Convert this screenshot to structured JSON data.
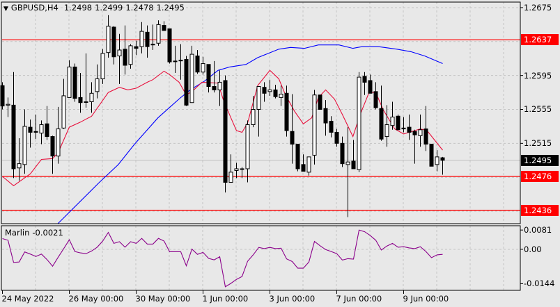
{
  "header": {
    "symbol": "GBPUSD,H4",
    "open": "1.2498",
    "high": "1.2499",
    "low": "1.2478",
    "close": "1.2495"
  },
  "price_axis": {
    "labels": [
      "1.2675",
      "1.2595",
      "1.2555",
      "1.2515"
    ],
    "range": [
      1.24203,
      1.26815
    ],
    "grid_step": 0.004,
    "grid_top": 1.2675
  },
  "levels": [
    {
      "label": "1.2637",
      "price": 1.2637,
      "color": "#ff0000"
    },
    {
      "label": "1.2476",
      "price": 1.2476,
      "color": "#ff0000"
    },
    {
      "label": "1.2436",
      "price": 1.2436,
      "color": "#ff0000"
    }
  ],
  "current_price": {
    "label": "1.2495",
    "price": 1.2495,
    "color": "#000000"
  },
  "indicator": {
    "name": "Marlin",
    "value": "-0.0021",
    "color": "#8b008b",
    "axis_labels": [
      {
        "label": "0.0081",
        "value": 0.0081
      },
      {
        "label": "0.00",
        "value": 0
      },
      {
        "label": "-0.0144",
        "value": -0.0144
      }
    ],
    "range": [
      -0.0172,
      0.0099
    ],
    "values": [
      0.0045,
      0.0038,
      -0.0055,
      -0.0053,
      -0.0011,
      -0.002,
      -0.003,
      -0.002,
      -0.0043,
      -0.0071,
      -0.0033,
      0.0003,
      0.004,
      -0.0009,
      -0.0015,
      -0.0018,
      -0.0007,
      0.0009,
      0.0035,
      0.0071,
      0.0025,
      0.0032,
      0.0009,
      0.0032,
      0.0025,
      0.0046,
      0.0022,
      0.0022,
      0.0046,
      0.0035,
      -0.001,
      -0.001,
      -0.001,
      -0.0069,
      0.0001,
      -0.0021,
      -0.0013,
      -0.0038,
      -0.0044,
      -0.0031,
      -0.0157,
      -0.0143,
      -0.0126,
      -0.0114,
      -0.005,
      -0.0023,
      0.0008,
      0.0003,
      0.0008,
      0.0003,
      0.0005,
      -0.004,
      -0.0051,
      -0.0079,
      -0.0079,
      -0.0053,
      0.0033,
      0.0015,
      -0.0001,
      -0.0009,
      -0.0018,
      -0.0045,
      -0.0039,
      -0.0041,
      0.0081,
      0.0074,
      0.0058,
      0.0038,
      -0.0003,
      0.0014,
      0.0025,
      0.0009,
      0.0011,
      0.0006,
      0.0003,
      0.0011,
      -0.0009,
      -0.0035,
      -0.0023,
      -0.0021
    ]
  },
  "time_axis": {
    "labels": [
      {
        "label": "24 May 2022",
        "bar": 0
      },
      {
        "label": "26 May 00:00",
        "bar": 12
      },
      {
        "label": "30 May 00:00",
        "bar": 24
      },
      {
        "label": "1 Jun 00:00",
        "bar": 36
      },
      {
        "label": "3 Jun 00:00",
        "bar": 48
      },
      {
        "label": "7 Jun 00:00",
        "bar": 60
      },
      {
        "label": "9 Jun 00:00",
        "bar": 72
      }
    ]
  },
  "colors": {
    "ma_fast": "#e8103c",
    "ma_slow": "#0000ff",
    "level": "#ff0000",
    "background": "#e8e8e8"
  },
  "ma_fast": [
    [
      0,
      1.2476
    ],
    [
      2,
      1.2465
    ],
    [
      5,
      1.2479
    ],
    [
      7,
      1.2496
    ],
    [
      9,
      1.2497
    ],
    [
      10,
      1.2504
    ],
    [
      12,
      1.2534
    ],
    [
      14,
      1.254
    ],
    [
      16,
      1.2547
    ],
    [
      17.5,
      1.2561
    ],
    [
      19,
      1.2575
    ],
    [
      21,
      1.2581
    ],
    [
      22.5,
      1.2578
    ],
    [
      24,
      1.258
    ],
    [
      26,
      1.2587
    ],
    [
      27,
      1.259
    ],
    [
      29,
      1.26
    ],
    [
      30,
      1.2596
    ],
    [
      31.7,
      1.2587
    ],
    [
      33,
      1.2572
    ],
    [
      34.2,
      1.2577
    ],
    [
      35.8,
      1.2587
    ],
    [
      38.7,
      1.2586
    ],
    [
      39.6,
      1.2567
    ],
    [
      41,
      1.2545
    ],
    [
      42,
      1.253
    ],
    [
      43,
      1.2528
    ],
    [
      44,
      1.2539
    ],
    [
      45.8,
      1.2583
    ],
    [
      48,
      1.2601
    ],
    [
      49.6,
      1.2591
    ],
    [
      50.8,
      1.2572
    ],
    [
      52.4,
      1.2553
    ],
    [
      54,
      1.2538
    ],
    [
      55.5,
      1.2545
    ],
    [
      56.7,
      1.2569
    ],
    [
      58,
      1.2578
    ],
    [
      59.6,
      1.2567
    ],
    [
      61,
      1.2549
    ],
    [
      62.9,
      1.2523
    ],
    [
      64.2,
      1.2549
    ],
    [
      65.8,
      1.2575
    ],
    [
      67,
      1.2575
    ],
    [
      68.3,
      1.2555
    ],
    [
      70.4,
      1.2532
    ],
    [
      72,
      1.2526
    ],
    [
      75,
      1.2532
    ],
    [
      76.2,
      1.253
    ],
    [
      79,
      1.2507
    ]
  ],
  "ma_slow": [
    [
      9.9,
      1.242
    ],
    [
      17.4,
      1.2469
    ],
    [
      20.8,
      1.249
    ],
    [
      23.7,
      1.2514
    ],
    [
      27.9,
      1.2545
    ],
    [
      32,
      1.2569
    ],
    [
      33.7,
      1.2578
    ],
    [
      36.2,
      1.2588
    ],
    [
      38.7,
      1.2601
    ],
    [
      40.8,
      1.2605
    ],
    [
      43.7,
      1.2608
    ],
    [
      45.8,
      1.2616
    ],
    [
      49.6,
      1.2626
    ],
    [
      51.7,
      1.2628
    ],
    [
      54.2,
      1.2627
    ],
    [
      56.7,
      1.2631
    ],
    [
      60.4,
      1.2631
    ],
    [
      62.9,
      1.2627
    ],
    [
      64.6,
      1.2629
    ],
    [
      67.4,
      1.2629
    ],
    [
      70.8,
      1.2626
    ],
    [
      73.3,
      1.2623
    ],
    [
      75.8,
      1.2618
    ],
    [
      79,
      1.2609
    ]
  ],
  "candles": [
    [
      1.2583,
      1.2587,
      1.2555,
      1.2559
    ],
    [
      1.256,
      1.2569,
      1.2546,
      1.2561
    ],
    [
      1.256,
      1.2599,
      1.2474,
      1.2485
    ],
    [
      1.2486,
      1.2521,
      1.2471,
      1.2491
    ],
    [
      1.249,
      1.2555,
      1.2479,
      1.2535
    ],
    [
      1.2534,
      1.2543,
      1.251,
      1.2528
    ],
    [
      1.2529,
      1.2549,
      1.252,
      1.2528
    ],
    [
      1.2527,
      1.2542,
      1.2514,
      1.2537
    ],
    [
      1.2538,
      1.2559,
      1.2519,
      1.2523
    ],
    [
      1.2523,
      1.2524,
      1.2479,
      1.25
    ],
    [
      1.25,
      1.2558,
      1.2491,
      1.2532
    ],
    [
      1.2533,
      1.2591,
      1.2532,
      1.2571
    ],
    [
      1.2569,
      1.2613,
      1.2569,
      1.2605
    ],
    [
      1.2605,
      1.2609,
      1.2564,
      1.2568
    ],
    [
      1.2569,
      1.2598,
      1.2551,
      1.2563
    ],
    [
      1.2564,
      1.2621,
      1.2557,
      1.2564
    ],
    [
      1.2564,
      1.2587,
      1.2551,
      1.2574
    ],
    [
      1.2576,
      1.2608,
      1.2568,
      1.2591
    ],
    [
      1.2591,
      1.2626,
      1.2585,
      1.2621
    ],
    [
      1.2622,
      1.2666,
      1.2616,
      1.2653
    ],
    [
      1.2652,
      1.2653,
      1.2608,
      1.2617
    ],
    [
      1.2618,
      1.2644,
      1.2585,
      1.2625
    ],
    [
      1.2626,
      1.2654,
      1.2596,
      1.2607
    ],
    [
      1.2608,
      1.2632,
      1.2603,
      1.263
    ],
    [
      1.2629,
      1.2636,
      1.2619,
      1.2627
    ],
    [
      1.2629,
      1.2658,
      1.2621,
      1.2647
    ],
    [
      1.2646,
      1.2654,
      1.2616,
      1.2629
    ],
    [
      1.2632,
      1.2655,
      1.2625,
      1.2631
    ],
    [
      1.2633,
      1.266,
      1.263,
      1.2655
    ],
    [
      1.2654,
      1.2659,
      1.2648,
      1.2648
    ],
    [
      1.265,
      1.265,
      1.2609,
      1.2611
    ],
    [
      1.2612,
      1.263,
      1.2598,
      1.2612
    ],
    [
      1.2613,
      1.2632,
      1.259,
      1.2613
    ],
    [
      1.2614,
      1.2618,
      1.2559,
      1.256
    ],
    [
      1.2563,
      1.263,
      1.2563,
      1.262
    ],
    [
      1.2618,
      1.2625,
      1.2597,
      1.2599
    ],
    [
      1.2599,
      1.2617,
      1.2596,
      1.2609
    ],
    [
      1.2608,
      1.2608,
      1.2575,
      1.2582
    ],
    [
      1.2582,
      1.2612,
      1.2575,
      1.2578
    ],
    [
      1.2578,
      1.2601,
      1.2559,
      1.2587
    ],
    [
      1.2589,
      1.2595,
      1.2457,
      1.2469
    ],
    [
      1.2469,
      1.2502,
      1.2469,
      1.2481
    ],
    [
      1.2483,
      1.2492,
      1.2474,
      1.2485
    ],
    [
      1.2485,
      1.2487,
      1.2474,
      1.2485
    ],
    [
      1.2485,
      1.2542,
      1.2469,
      1.2537
    ],
    [
      1.2537,
      1.2571,
      1.2534,
      1.2555
    ],
    [
      1.2555,
      1.2582,
      1.2523,
      1.2582
    ],
    [
      1.2581,
      1.2587,
      1.2564,
      1.2574
    ],
    [
      1.2576,
      1.259,
      1.2571,
      1.2578
    ],
    [
      1.2578,
      1.2584,
      1.2568,
      1.257
    ],
    [
      1.2569,
      1.2583,
      1.2559,
      1.2573
    ],
    [
      1.2574,
      1.2583,
      1.2523,
      1.253
    ],
    [
      1.2529,
      1.2573,
      1.2491,
      1.2514
    ],
    [
      1.2514,
      1.2514,
      1.2482,
      1.2485
    ],
    [
      1.249,
      1.2502,
      1.2482,
      1.2482
    ],
    [
      1.2481,
      1.2499,
      1.2477,
      1.2499
    ],
    [
      1.2501,
      1.2578,
      1.249,
      1.2572
    ],
    [
      1.2572,
      1.2572,
      1.2555,
      1.2555
    ],
    [
      1.2556,
      1.2566,
      1.2524,
      1.2539
    ],
    [
      1.2541,
      1.2547,
      1.2522,
      1.2528
    ],
    [
      1.2528,
      1.2532,
      1.2511,
      1.2515
    ],
    [
      1.2515,
      1.2523,
      1.2487,
      1.2491
    ],
    [
      1.249,
      1.2534,
      1.2428,
      1.2493
    ],
    [
      1.2494,
      1.2519,
      1.2485,
      1.2485
    ],
    [
      1.2484,
      1.2599,
      1.2481,
      1.2593
    ],
    [
      1.2594,
      1.2599,
      1.2572,
      1.2587
    ],
    [
      1.2589,
      1.2596,
      1.2574,
      1.2574
    ],
    [
      1.2576,
      1.2587,
      1.2555,
      1.2557
    ],
    [
      1.2556,
      1.2583,
      1.2518,
      1.252
    ],
    [
      1.2523,
      1.256,
      1.2511,
      1.2537
    ],
    [
      1.2536,
      1.2564,
      1.2531,
      1.2546
    ],
    [
      1.2547,
      1.2549,
      1.2531,
      1.2531
    ],
    [
      1.2533,
      1.2546,
      1.2528,
      1.2532
    ],
    [
      1.2534,
      1.2549,
      1.2519,
      1.2528
    ],
    [
      1.2529,
      1.2531,
      1.2491,
      1.2525
    ],
    [
      1.2524,
      1.2549,
      1.2511,
      1.2531
    ],
    [
      1.2532,
      1.2559,
      1.2506,
      1.2514
    ],
    [
      1.2514,
      1.2514,
      1.2488,
      1.2488
    ],
    [
      1.249,
      1.2507,
      1.2482,
      1.2499
    ],
    [
      1.2498,
      1.2499,
      1.2478,
      1.2495
    ]
  ]
}
